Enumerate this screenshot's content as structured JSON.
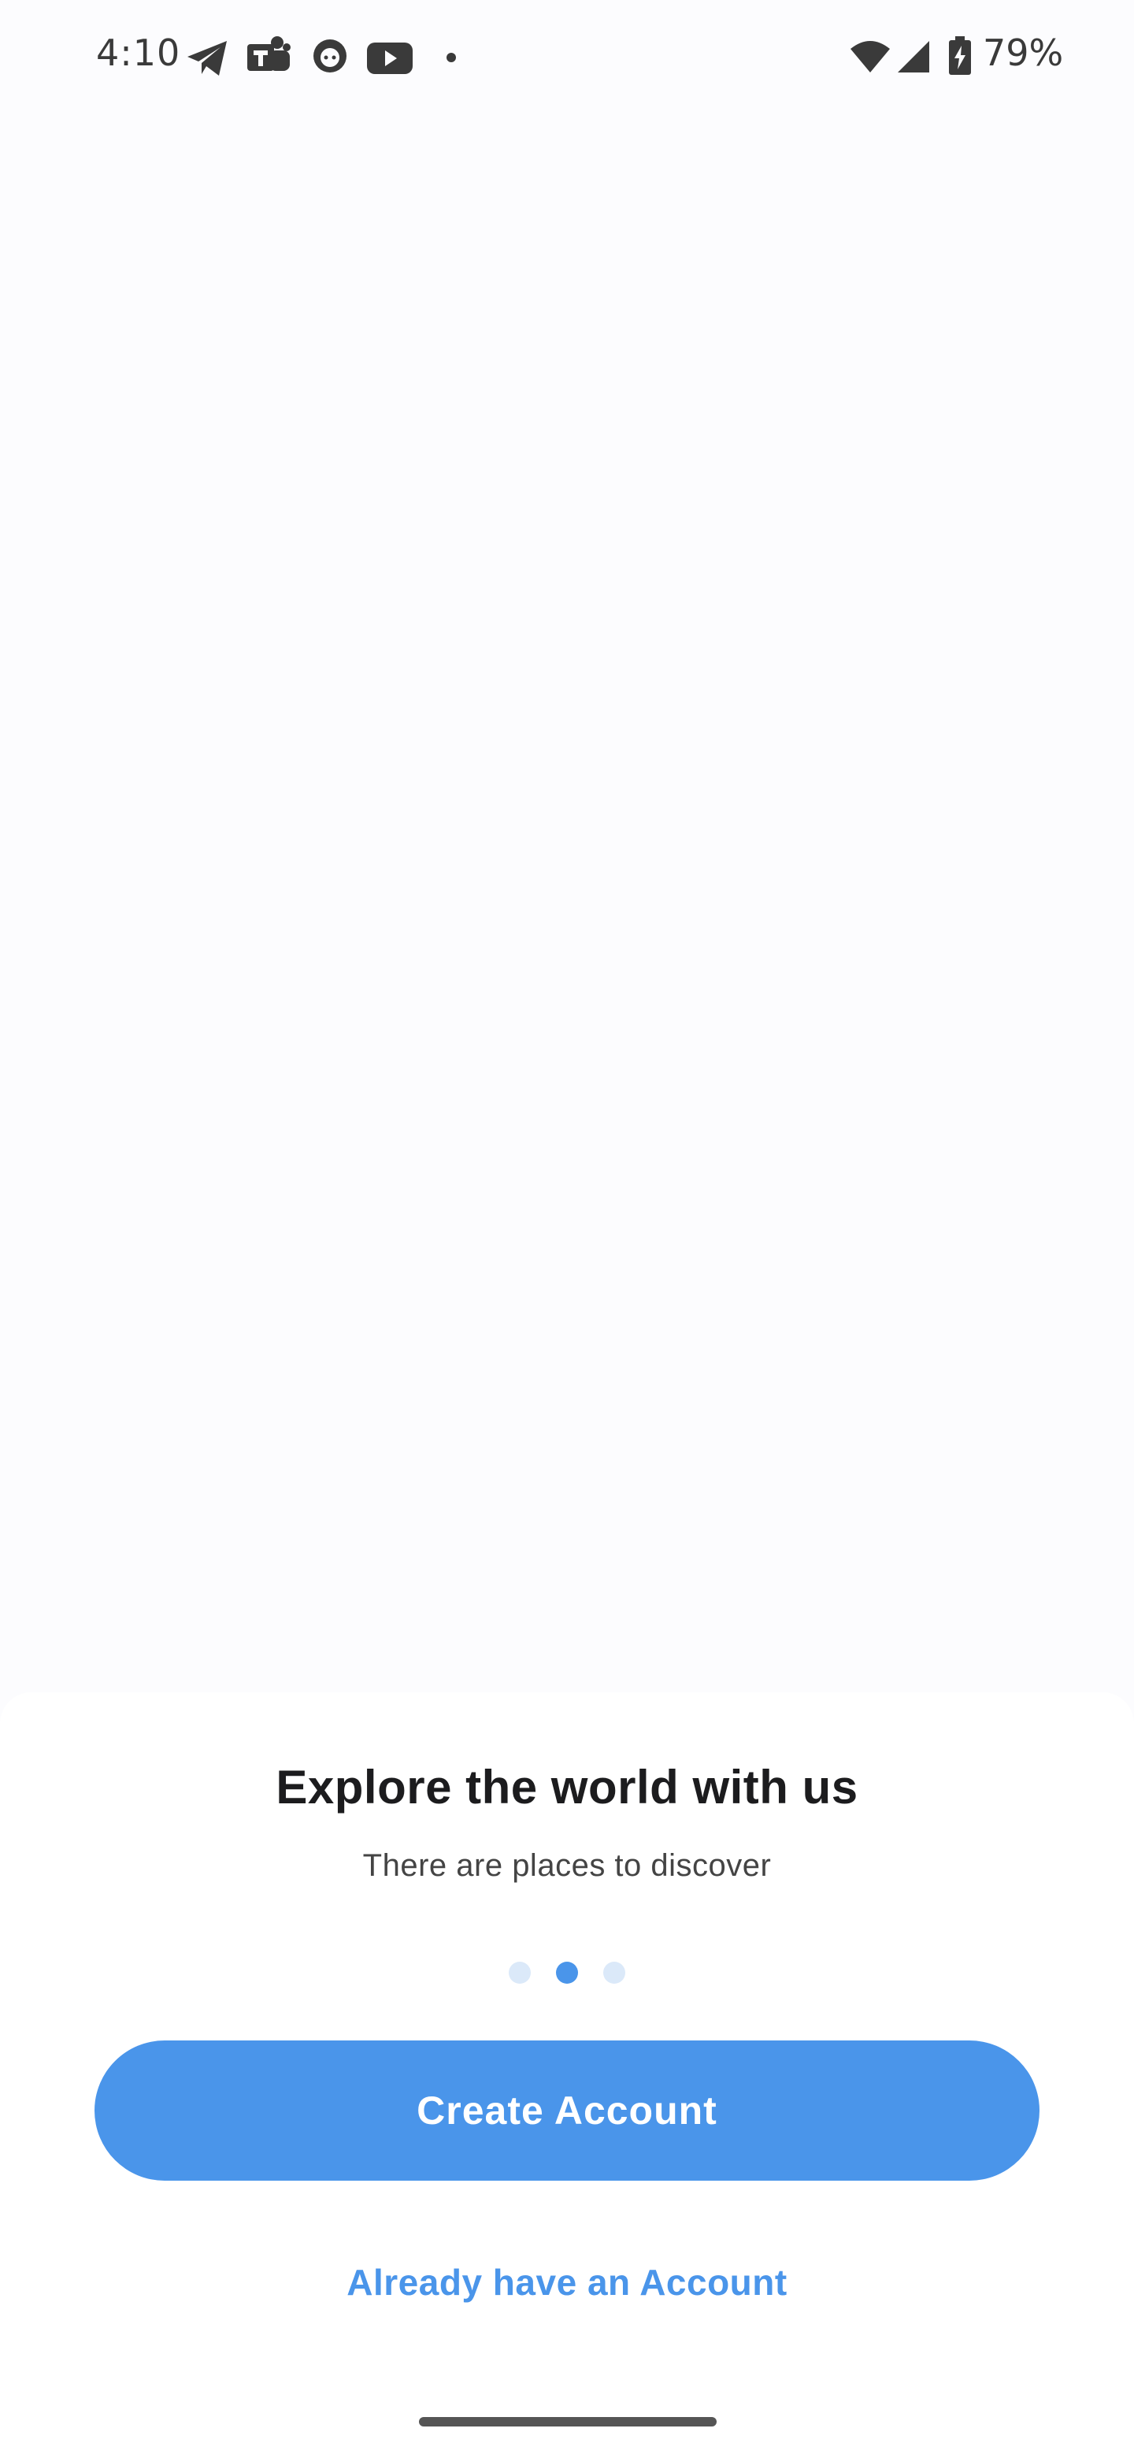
{
  "status_bar": {
    "time": "4:10",
    "battery": "79%",
    "icons": [
      "telegram-icon",
      "teams-icon",
      "github-icon",
      "youtube-icon",
      "dot-icon",
      "wifi-icon",
      "signal-icon",
      "battery-charging-icon"
    ]
  },
  "onboarding": {
    "title": "Explore the world with us",
    "subtitle": "There are places to discover",
    "pages_total": 3,
    "current_page": 2,
    "create_account_label": "Create Account",
    "login_label": "Already have an Account"
  },
  "colors": {
    "accent": "#4a95ea",
    "dot_inactive": "#dbe9f9",
    "background": "#fcfcfe",
    "sheet": "#ffffff"
  }
}
